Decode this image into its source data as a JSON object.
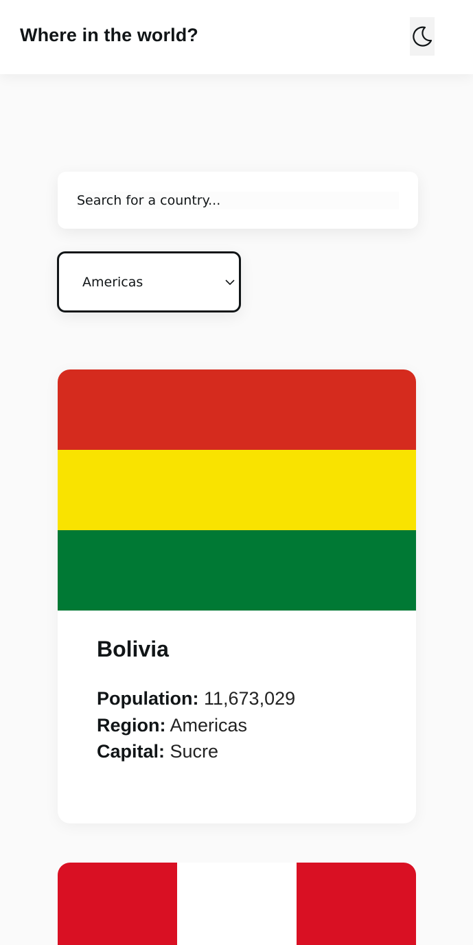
{
  "header": {
    "title": "Where in the world?",
    "theme_icon": "moon-icon"
  },
  "search": {
    "placeholder": "Search for a country...",
    "value": ""
  },
  "filter": {
    "selected": "Americas",
    "icon": "chevron-down-icon"
  },
  "countries": [
    {
      "name": "Bolivia",
      "flag_colors": [
        "#d52b1e",
        "#f9e300",
        "#007934"
      ],
      "population_label": "Population:",
      "population": "11,673,029",
      "region_label": "Region:",
      "region": "Americas",
      "capital_label": "Capital:",
      "capital": "Sucre"
    },
    {
      "flag_colors": [
        "#d91023",
        "#ffffff",
        "#d91023"
      ]
    }
  ]
}
